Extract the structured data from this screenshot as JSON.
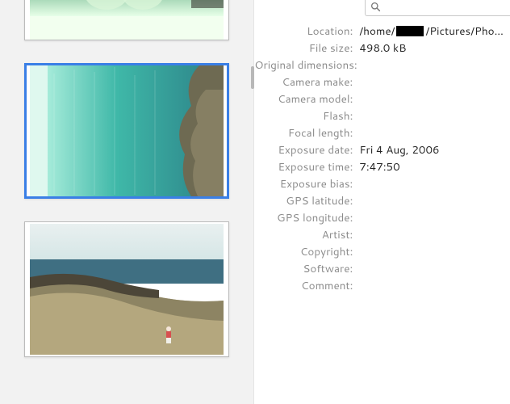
{
  "search": {
    "placeholder": ""
  },
  "location": {
    "prefix": "/home/",
    "suffix": "/Pictures/Pho…"
  },
  "props": {
    "location_label": "Location:",
    "file_size_label": "File size:",
    "file_size_value": "498.0 kB",
    "orig_dim_label": "Original dimensions:",
    "orig_dim_value": "",
    "camera_make_label": "Camera make:",
    "camera_make_value": "",
    "camera_model_label": "Camera model:",
    "camera_model_value": "",
    "flash_label": "Flash:",
    "flash_value": "",
    "focal_length_label": "Focal length:",
    "focal_length_value": "",
    "exposure_date_label": "Exposure date:",
    "exposure_date_value": "Fri 4 Aug, 2006",
    "exposure_time_label": "Exposure time:",
    "exposure_time_value": "7:47:50",
    "exposure_bias_label": "Exposure bias:",
    "exposure_bias_value": "",
    "gps_lat_label": "GPS latitude:",
    "gps_lat_value": "",
    "gps_lon_label": "GPS longitude:",
    "gps_lon_value": "",
    "artist_label": "Artist:",
    "artist_value": "",
    "copyright_label": "Copyright:",
    "copyright_value": "",
    "software_label": "Software:",
    "software_value": "",
    "comment_label": "Comment:",
    "comment_value": ""
  }
}
